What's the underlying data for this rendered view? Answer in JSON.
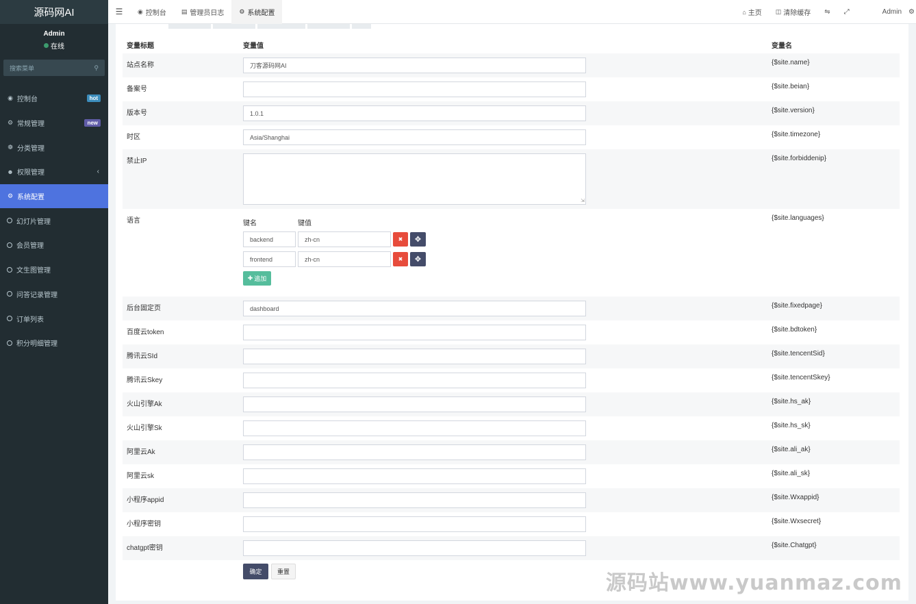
{
  "sidebar": {
    "logo": "源码网AI",
    "user_name": "Admin",
    "user_status": "在线",
    "search_placeholder": "搜索菜单",
    "items": [
      {
        "label": "控制台",
        "badge": "hot"
      },
      {
        "label": "常规管理",
        "badge": "new"
      },
      {
        "label": "分类管理"
      },
      {
        "label": "权限管理",
        "caret": "‹"
      },
      {
        "label": "系统配置"
      },
      {
        "label": "幻灯片管理"
      },
      {
        "label": "会员管理"
      },
      {
        "label": "文生图管理"
      },
      {
        "label": "问答记录管理"
      },
      {
        "label": "订单列表"
      },
      {
        "label": "积分明细管理"
      }
    ]
  },
  "topbar": {
    "tabs": [
      {
        "label": "控制台",
        "icon": "dashboard-icon"
      },
      {
        "label": "管理员日志",
        "icon": "list-icon"
      },
      {
        "label": "系统配置",
        "icon": "gear-icon"
      }
    ],
    "home": "主页",
    "clear_cache": "清除缓存",
    "admin": "Admin"
  },
  "table": {
    "headers": {
      "title": "变量标题",
      "value": "变量值",
      "name": "变量名"
    },
    "rows": [
      {
        "title": "站点名称",
        "value": "刀客源码网AI",
        "name": "{$site.name}"
      },
      {
        "title": "备案号",
        "value": "",
        "name": "{$site.beian}"
      },
      {
        "title": "版本号",
        "value": "1.0.1",
        "name": "{$site.version}"
      },
      {
        "title": "时区",
        "value": "Asia/Shanghai",
        "name": "{$site.timezone}"
      },
      {
        "title": "禁止IP",
        "value": "",
        "name": "{$site.forbiddenip}"
      },
      {
        "title": "语言",
        "name": "{$site.languages}"
      },
      {
        "title": "后台固定页",
        "value": "dashboard",
        "name": "{$site.fixedpage}"
      },
      {
        "title": "百度云token",
        "value": "",
        "name": "{$site.bdtoken}"
      },
      {
        "title": "腾讯云SId",
        "value": "",
        "name": "{$site.tencentSid}"
      },
      {
        "title": "腾讯云Skey",
        "value": "",
        "name": "{$site.tencentSkey}"
      },
      {
        "title": "火山引擎Ak",
        "value": "",
        "name": "{$site.hs_ak}"
      },
      {
        "title": "火山引擎Sk",
        "value": "",
        "name": "{$site.hs_sk}"
      },
      {
        "title": "阿里云Ak",
        "value": "",
        "name": "{$site.ali_ak}"
      },
      {
        "title": "阿里云sk",
        "value": "",
        "name": "{$site.ali_sk}"
      },
      {
        "title": "小程序appid",
        "value": "",
        "name": "{$site.Wxappid}"
      },
      {
        "title": "小程序密钥",
        "value": "",
        "name": "{$site.Wxsecret}"
      },
      {
        "title": "chatgpt密钥",
        "value": "",
        "name": "{$site.Chatgpt}"
      }
    ],
    "languages": {
      "key_header": "键名",
      "value_header": "键值",
      "pairs": [
        {
          "key": "backend",
          "value": "zh-cn"
        },
        {
          "key": "frontend",
          "value": "zh-cn"
        }
      ],
      "add_label": "追加"
    }
  },
  "buttons": {
    "ok": "确定",
    "reset": "重置"
  },
  "watermark": "源码站www.yuanmaz.com"
}
